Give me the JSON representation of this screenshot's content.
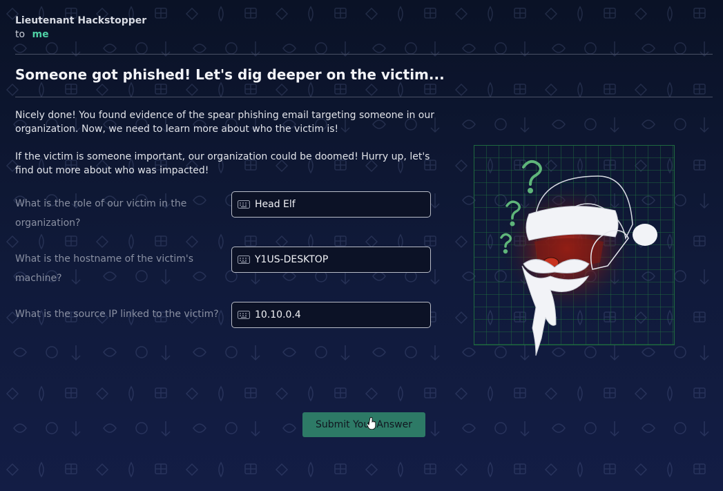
{
  "email": {
    "sender": "Lieutenant Hackstopper",
    "to_label": "to",
    "recipient": "me",
    "title": "Someone got phished! Let's dig deeper on the victim...",
    "paragraphs": [
      "Nicely done! You found evidence of the spear phishing email targeting someone in our organization. Now, we need to learn more about who the victim is!",
      "If the victim is someone important, our organization could be doomed! Hurry up, let's find out more about who was impacted!"
    ]
  },
  "questions": [
    {
      "label": "What is the role of our victim in the organization?",
      "value": "Head Elf"
    },
    {
      "label": "What is the hostname of the victim's machine?",
      "value": "Y1US-DESKTOP"
    },
    {
      "label": "What is the source IP linked to the victim?",
      "value": "10.10.0.4"
    }
  ],
  "submit_label": "Submit Your Answer",
  "colors": {
    "accent": "#4fd1a5",
    "button": "#2d7a66",
    "background": "#0f1734",
    "glow": "#c0281a"
  },
  "icons": [
    "keyboard-icon",
    "hand-pointer-cursor",
    "santa-illustration",
    "question-mark-icon"
  ]
}
